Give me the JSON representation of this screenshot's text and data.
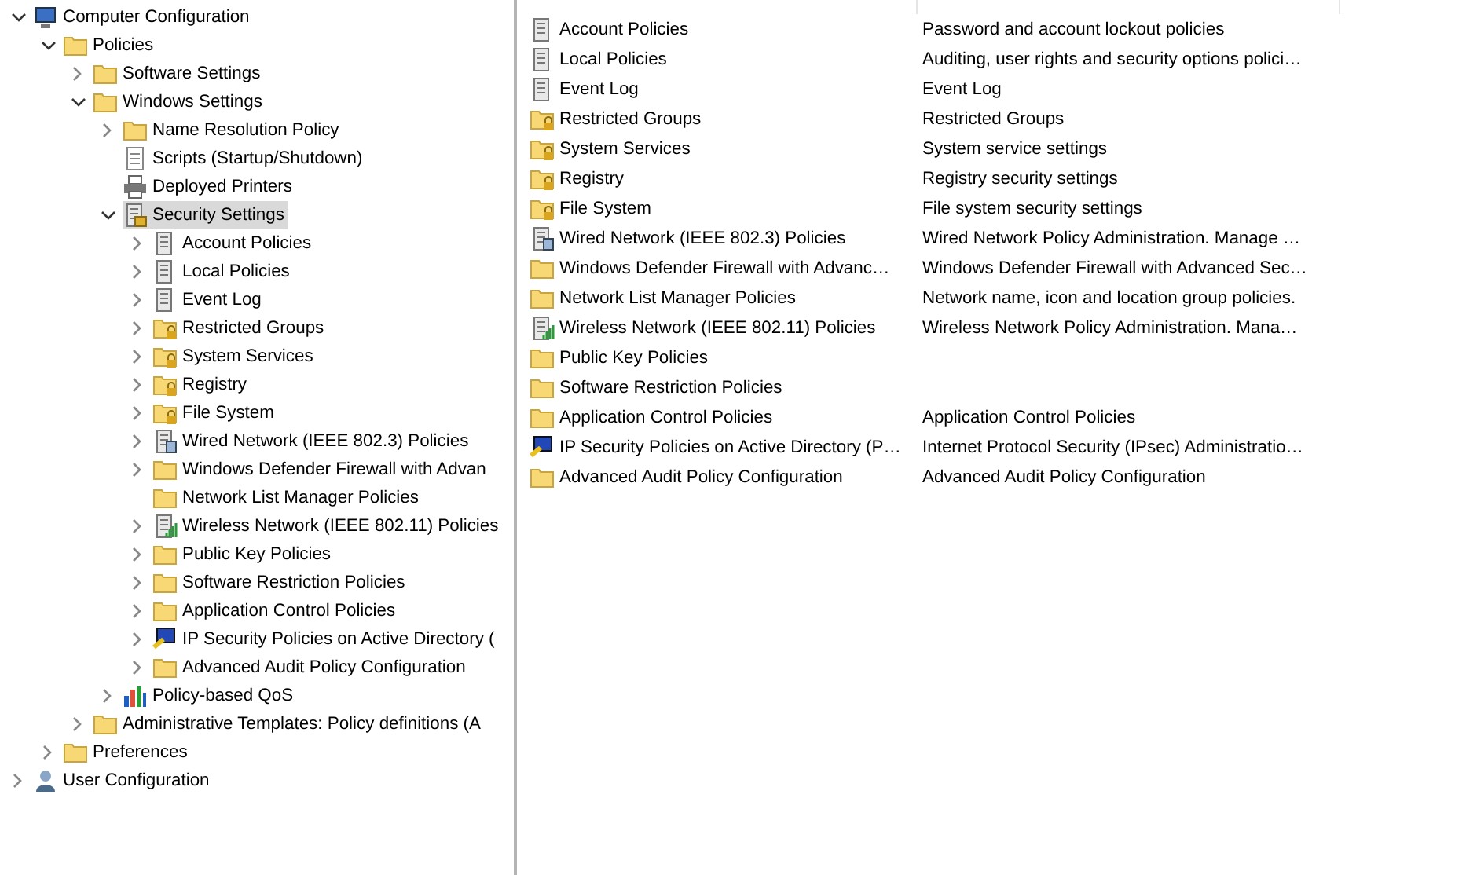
{
  "tree": [
    {
      "label": "Computer Configuration",
      "kind": "computer",
      "expanded": true,
      "selected": false,
      "children": [
        {
          "label": "Policies",
          "kind": "folder",
          "expanded": true,
          "selected": false,
          "children": [
            {
              "label": "Software Settings",
              "kind": "folder",
              "expanded": false,
              "selected": false
            },
            {
              "label": "Windows Settings",
              "kind": "folder",
              "expanded": true,
              "selected": false,
              "children": [
                {
                  "label": "Name Resolution Policy",
                  "kind": "folder",
                  "expanded": false,
                  "selected": false
                },
                {
                  "label": "Scripts (Startup/Shutdown)",
                  "kind": "script",
                  "selected": false
                },
                {
                  "label": "Deployed Printers",
                  "kind": "printer",
                  "selected": false
                },
                {
                  "label": "Security Settings",
                  "kind": "security",
                  "expanded": true,
                  "selected": true,
                  "children": [
                    {
                      "label": "Account Policies",
                      "kind": "server",
                      "expanded": false,
                      "selected": false
                    },
                    {
                      "label": "Local Policies",
                      "kind": "server",
                      "expanded": false,
                      "selected": false
                    },
                    {
                      "label": "Event Log",
                      "kind": "server",
                      "expanded": false,
                      "selected": false
                    },
                    {
                      "label": "Restricted Groups",
                      "kind": "lockfolder",
                      "expanded": false,
                      "selected": false
                    },
                    {
                      "label": "System Services",
                      "kind": "lockfolder",
                      "expanded": false,
                      "selected": false
                    },
                    {
                      "label": "Registry",
                      "kind": "lockfolder",
                      "expanded": false,
                      "selected": false
                    },
                    {
                      "label": "File System",
                      "kind": "lockfolder",
                      "expanded": false,
                      "selected": false
                    },
                    {
                      "label": "Wired Network (IEEE 802.3) Policies",
                      "kind": "wired",
                      "expanded": false,
                      "selected": false
                    },
                    {
                      "label": "Windows Defender Firewall with Advan",
                      "kind": "folder",
                      "expanded": false,
                      "selected": false
                    },
                    {
                      "label": "Network List Manager Policies",
                      "kind": "folder",
                      "selected": false
                    },
                    {
                      "label": "Wireless Network (IEEE 802.11) Policies",
                      "kind": "wireless",
                      "expanded": false,
                      "selected": false
                    },
                    {
                      "label": "Public Key Policies",
                      "kind": "folder",
                      "expanded": false,
                      "selected": false
                    },
                    {
                      "label": "Software Restriction Policies",
                      "kind": "folder",
                      "expanded": false,
                      "selected": false
                    },
                    {
                      "label": "Application Control Policies",
                      "kind": "folder",
                      "expanded": false,
                      "selected": false
                    },
                    {
                      "label": "IP Security Policies on Active Directory (",
                      "kind": "ipsec",
                      "expanded": false,
                      "selected": false
                    },
                    {
                      "label": "Advanced Audit Policy Configuration",
                      "kind": "folder",
                      "expanded": false,
                      "selected": false
                    }
                  ]
                },
                {
                  "label": "Policy-based QoS",
                  "kind": "qos",
                  "expanded": false,
                  "selected": false
                }
              ]
            },
            {
              "label": "Administrative Templates: Policy definitions (A",
              "kind": "folder",
              "expanded": false,
              "selected": false
            }
          ]
        },
        {
          "label": "Preferences",
          "kind": "folder",
          "expanded": false,
          "selected": false
        }
      ]
    },
    {
      "label": "User Configuration",
      "kind": "user",
      "expanded": false,
      "selected": false
    }
  ],
  "list": [
    {
      "name": "Account Policies",
      "kind": "server",
      "description": "Password and account lockout policies"
    },
    {
      "name": "Local Policies",
      "kind": "server",
      "description": "Auditing, user rights and security options polici…"
    },
    {
      "name": "Event Log",
      "kind": "server",
      "description": "Event Log"
    },
    {
      "name": "Restricted Groups",
      "kind": "lockfolder",
      "description": "Restricted Groups"
    },
    {
      "name": "System Services",
      "kind": "lockfolder",
      "description": "System service settings"
    },
    {
      "name": "Registry",
      "kind": "lockfolder",
      "description": "Registry security settings"
    },
    {
      "name": "File System",
      "kind": "lockfolder",
      "description": "File system security settings"
    },
    {
      "name": "Wired Network (IEEE 802.3) Policies",
      "kind": "wired",
      "description": "Wired Network Policy Administration. Manage …"
    },
    {
      "name": "Windows Defender Firewall with Advanc…",
      "kind": "folder",
      "description": "Windows Defender Firewall with Advanced Sec…"
    },
    {
      "name": "Network List Manager Policies",
      "kind": "folder",
      "description": "Network name, icon and location group policies."
    },
    {
      "name": "Wireless Network (IEEE 802.11) Policies",
      "kind": "wireless",
      "description": "Wireless Network Policy Administration. Mana…"
    },
    {
      "name": "Public Key Policies",
      "kind": "folder"
    },
    {
      "name": "Software Restriction Policies",
      "kind": "folder"
    },
    {
      "name": "Application Control Policies",
      "kind": "folder",
      "description": "Application Control Policies"
    },
    {
      "name": "IP Security Policies on Active Directory (P…",
      "kind": "ipsec",
      "description": "Internet Protocol Security (IPsec) Administratio…"
    },
    {
      "name": "Advanced Audit Policy Configuration",
      "kind": "folder",
      "description": "Advanced Audit Policy Configuration"
    }
  ]
}
